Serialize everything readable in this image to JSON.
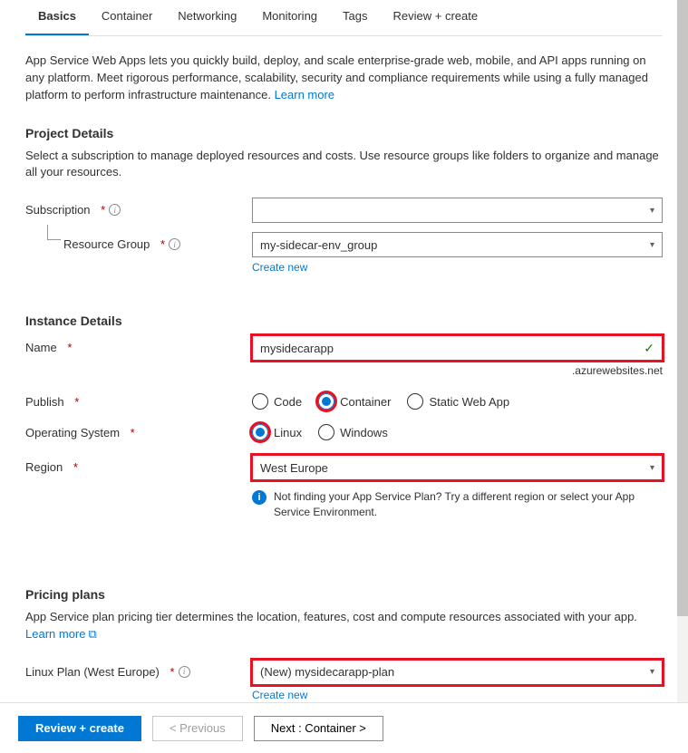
{
  "tabs": [
    "Basics",
    "Container",
    "Networking",
    "Monitoring",
    "Tags",
    "Review + create"
  ],
  "introText": "App Service Web Apps lets you quickly build, deploy, and scale enterprise-grade web, mobile, and API apps running on any platform. Meet rigorous performance, scalability, security and compliance requirements while using a fully managed platform to perform infrastructure maintenance.  ",
  "learnMore": "Learn more",
  "project": {
    "title": "Project Details",
    "desc": "Select a subscription to manage deployed resources and costs. Use resource groups like folders to organize and manage all your resources.",
    "subscriptionLabel": "Subscription",
    "subscriptionValue": "",
    "rgLabel": "Resource Group",
    "rgValue": "my-sidecar-env_group",
    "createNew": "Create new"
  },
  "instance": {
    "title": "Instance Details",
    "nameLabel": "Name",
    "nameValue": "mysidecarapp",
    "suffix": ".azurewebsites.net",
    "publishLabel": "Publish",
    "publishOptions": {
      "code": "Code",
      "container": "Container",
      "swa": "Static Web App"
    },
    "osLabel": "Operating System",
    "osOptions": {
      "linux": "Linux",
      "windows": "Windows"
    },
    "regionLabel": "Region",
    "regionValue": "West Europe",
    "infoText": "Not finding your App Service Plan? Try a different region or select your App Service Environment."
  },
  "pricing": {
    "title": "Pricing plans",
    "desc": "App Service plan pricing tier determines the location, features, cost and compute resources associated with your app.",
    "learnMore": "Learn more",
    "planLabel": "Linux Plan (West Europe)",
    "planValue": "(New) mysidecarapp-plan",
    "createNew": "Create new"
  },
  "footer": {
    "review": "Review + create",
    "prev": "< Previous",
    "next": "Next : Container >"
  }
}
